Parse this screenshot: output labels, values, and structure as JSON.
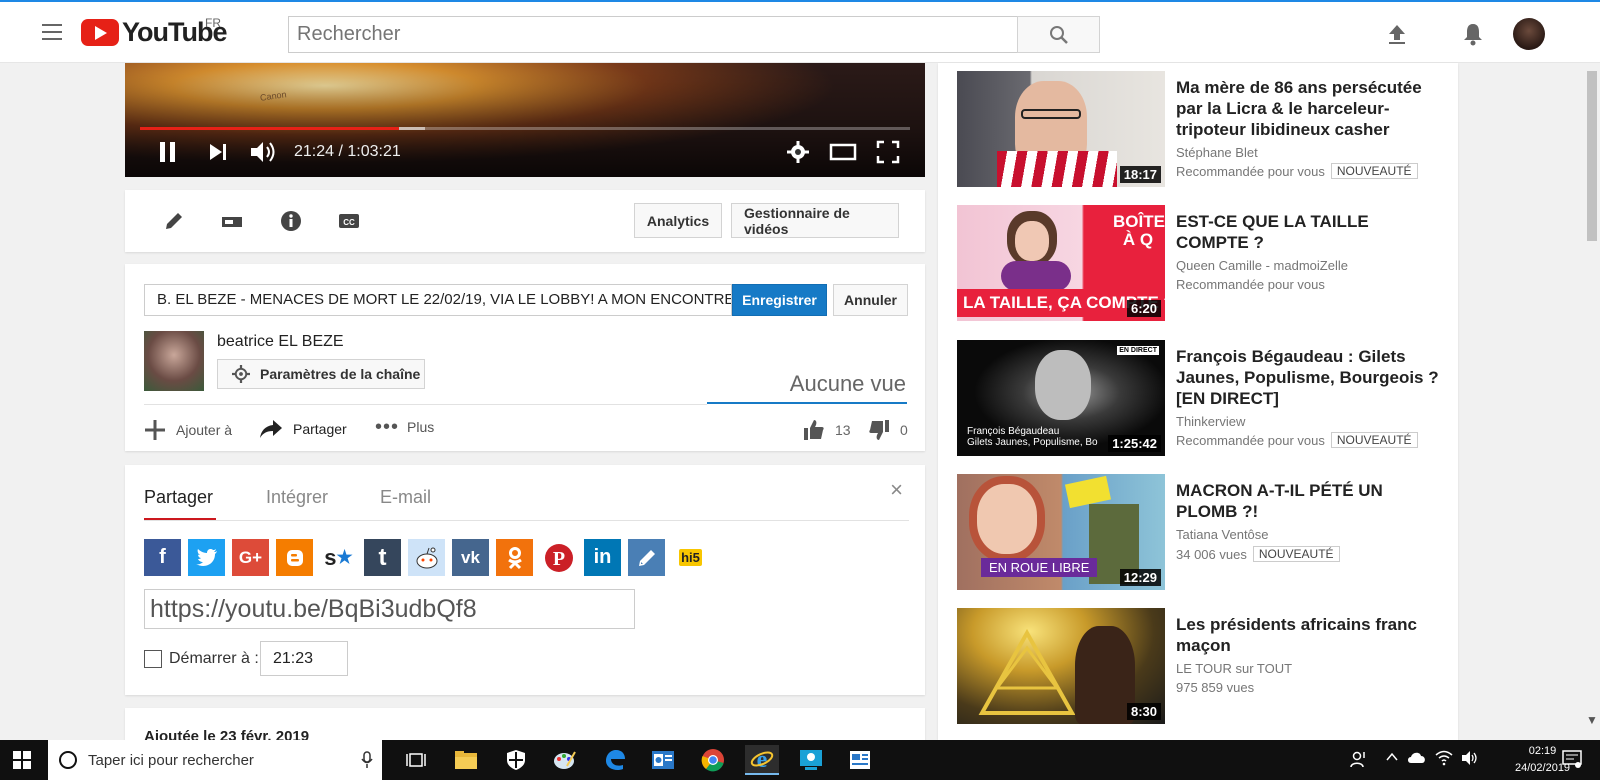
{
  "header": {
    "logo_text": "YouTube",
    "country": "FR",
    "search_placeholder": "Rechercher"
  },
  "player": {
    "time": "21:24 / 1:03:21",
    "progress_fraction": 0.337,
    "buffer_fraction": 0.37,
    "overlay_text": "Canon"
  },
  "owner_bar": {
    "analytics": "Analytics",
    "video_manager": "Gestionnaire de vidéos"
  },
  "meta": {
    "title_value": "B. EL BEZE - MENACES DE MORT LE 22/02/19, VIA LE LOBBY! A MON ENCONTRE",
    "save": "Enregistrer",
    "cancel": "Annuler",
    "channel_name": "beatrice EL BEZE",
    "channel_settings": "Paramètres de la chaîne",
    "views": "Aucune vue",
    "add_to": "Ajouter à",
    "share": "Partager",
    "more": "Plus",
    "likes": "13",
    "dislikes": "0"
  },
  "share_panel": {
    "tabs": [
      "Partager",
      "Intégrer",
      "E-mail"
    ],
    "close": "×",
    "socials": [
      "facebook",
      "twitter",
      "google-plus",
      "blogger",
      "stumbleupon",
      "tumblr",
      "reddit",
      "vkontakte",
      "odnoklassniki",
      "pinterest",
      "linkedin",
      "livejournal",
      "hi5"
    ],
    "url": "https://youtu.be/BqBi3udbQf8",
    "start_at_label": "Démarrer à :",
    "start_time": "21:23"
  },
  "description": {
    "date": "Ajoutée le 23 févr. 2019"
  },
  "sidebar": {
    "items": [
      {
        "title": "Ma mère de 86 ans persécutée par la Licra & le harceleur-tripoteur libidineux casher",
        "channel": "Stéphane Blet",
        "meta": "Recommandée pour vous",
        "badge": "NOUVEAUTÉ",
        "duration": "18:17"
      },
      {
        "title": "EST-CE QUE LA TAILLE COMPTE ?",
        "channel": "Queen Camille - madmoiZelle",
        "meta": "Recommandée pour vous",
        "badge": "",
        "duration": "6:20",
        "thumb_text_top": "BOÎTE À Q",
        "thumb_text_bottom": "LA TAILLE, ÇA COMPTE ?"
      },
      {
        "title": "François Bégaudeau : Gilets Jaunes, Populisme, Bourgeois ? [EN DIRECT]",
        "channel": "Thinkerview",
        "meta": "Recommandée pour vous",
        "badge": "NOUVEAUTÉ",
        "duration": "1:25:42",
        "thumb_badge": "EN DIRECT",
        "thumb_caption": "François Bégaudeau",
        "thumb_caption2": "Gilets Jaunes, Populisme, Bo"
      },
      {
        "title": "MACRON A-T-IL PÉTÉ UN PLOMB ?!",
        "channel": "Tatiana Ventôse",
        "meta": "34 006 vues",
        "badge": "NOUVEAUTÉ",
        "duration": "12:29",
        "thumb_caption": "EN ROUE LIBRE"
      },
      {
        "title": "Les présidents africains franc maçon",
        "channel": "LE TOUR sur TOUT",
        "meta": "975 859 vues",
        "badge": "",
        "duration": "8:30"
      }
    ]
  },
  "taskbar": {
    "search_text": "Taper ici pour rechercher",
    "time": "02:19",
    "date": "24/02/2019"
  },
  "colors": {
    "youtube_red": "#e62117",
    "primary_blue": "#167ac6",
    "taskbar": "#101010"
  }
}
